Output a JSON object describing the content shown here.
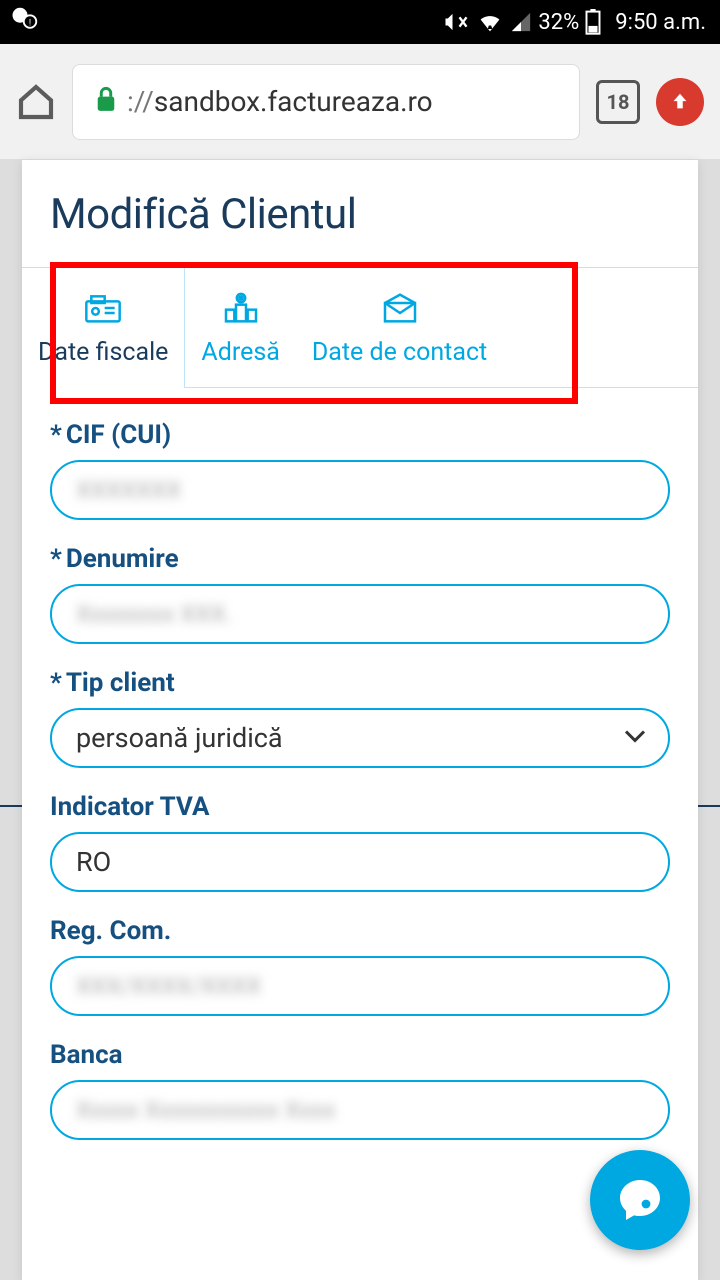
{
  "statusbar": {
    "battery_pct": "32%",
    "time": "9:50 a.m."
  },
  "browser": {
    "url_prefix": "://",
    "url_host": "sandbox.factureaza.ro",
    "tab_count": "18"
  },
  "page": {
    "title": "Modifică Clientul"
  },
  "tabs": {
    "fiscal": "Date fiscale",
    "address": "Adresă",
    "contact": "Date de contact"
  },
  "form": {
    "cif_label": "CIF (CUI)",
    "cif_value": "",
    "denumire_label": "Denumire",
    "denumire_value": "",
    "tip_label": "Tip client",
    "tip_value": "persoană juridică",
    "tva_label": "Indicator TVA",
    "tva_value": "RO",
    "regcom_label": "Reg. Com.",
    "regcom_value": "",
    "banca_label": "Banca",
    "banca_value": ""
  }
}
